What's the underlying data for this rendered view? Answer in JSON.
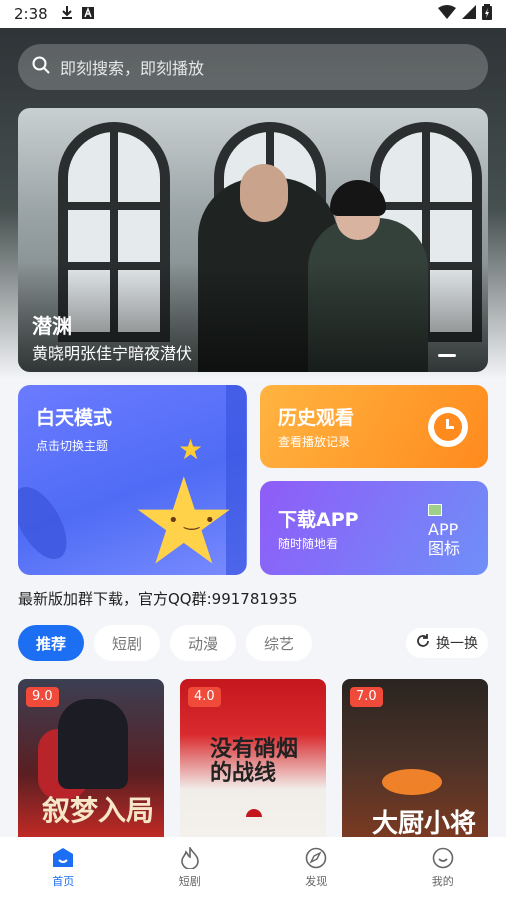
{
  "status_bar": {
    "time": "2:38"
  },
  "search": {
    "placeholder": "即刻搜索，即刻播放"
  },
  "banner": {
    "title": "潜渊",
    "subtitle": "黄晓明张佳宁暗夜潜伏"
  },
  "cards": {
    "day_mode": {
      "title": "白天模式",
      "subtitle": "点击切换主题"
    },
    "history": {
      "title": "历史观看",
      "subtitle": "查看播放记录"
    },
    "download": {
      "title": "下载APP",
      "subtitle": "随时随地看",
      "image_alt": "APP图标"
    }
  },
  "notice": "最新版加群下载，官方QQ群:991781935",
  "tabs": [
    {
      "label": "推荐",
      "active": true
    },
    {
      "label": "短剧",
      "active": false
    },
    {
      "label": "动漫",
      "active": false
    },
    {
      "label": "综艺",
      "active": false
    }
  ],
  "refresh_label": "换一换",
  "posters": [
    {
      "score": "9.0",
      "title": "叙梦入局"
    },
    {
      "score": "4.0",
      "title": "没有硝烟的战线"
    },
    {
      "score": "7.0",
      "title": "大厨小将"
    }
  ],
  "bottom_nav": [
    {
      "label": "首页",
      "active": true,
      "icon": "home-icon"
    },
    {
      "label": "短剧",
      "active": false,
      "icon": "flame-icon"
    },
    {
      "label": "发现",
      "active": false,
      "icon": "compass-icon"
    },
    {
      "label": "我的",
      "active": false,
      "icon": "smile-icon"
    }
  ],
  "colors": {
    "accent": "#1c6ef3",
    "history_card": "#ff9a2b",
    "day_card": "#5a6ff6",
    "score_badge": "#f04a3a"
  }
}
